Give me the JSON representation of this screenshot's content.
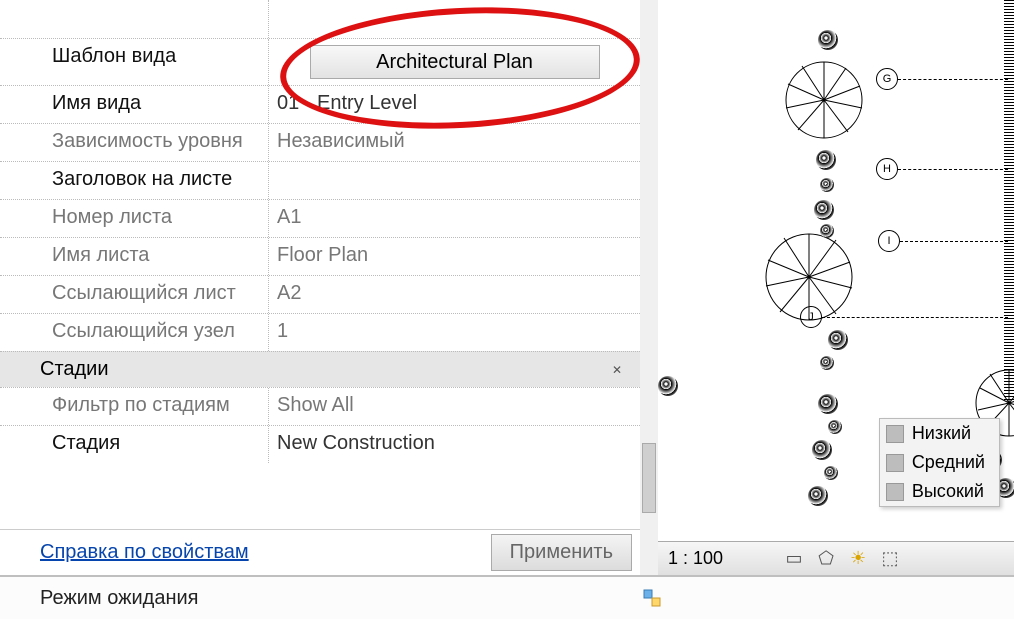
{
  "properties": {
    "rows": [
      {
        "label": "Шаблон вида",
        "button": "Architectural Plan",
        "dim": false
      },
      {
        "label": "Имя вида",
        "value": "01 - Entry Level",
        "dim": false
      },
      {
        "label": "Зависимость уровня",
        "value": "Независимый",
        "dim": true
      },
      {
        "label": "Заголовок на листе",
        "value": "",
        "dim": false
      },
      {
        "label": "Номер листа",
        "value": "A1",
        "dim": true
      },
      {
        "label": "Имя листа",
        "value": "Floor Plan",
        "dim": true
      },
      {
        "label": "Ссылающийся лист",
        "value": "A2",
        "dim": true
      },
      {
        "label": "Ссылающийся узел",
        "value": "1",
        "dim": true
      }
    ],
    "group_header": "Стадии",
    "phase_rows": [
      {
        "label": "Фильтр по стадиям",
        "value": "Show All",
        "dim": true
      },
      {
        "label": "Стадия",
        "value": "New Construction",
        "dim": false
      }
    ],
    "help_link": "Справка по свойствам",
    "apply": "Применить"
  },
  "status": {
    "ready": "Режим ожидания"
  },
  "viewport": {
    "scale": "1 : 100",
    "grid_labels": [
      "G",
      "H",
      "I",
      "J"
    ],
    "detail_options": [
      "Низкий",
      "Средний",
      "Высокий"
    ]
  }
}
